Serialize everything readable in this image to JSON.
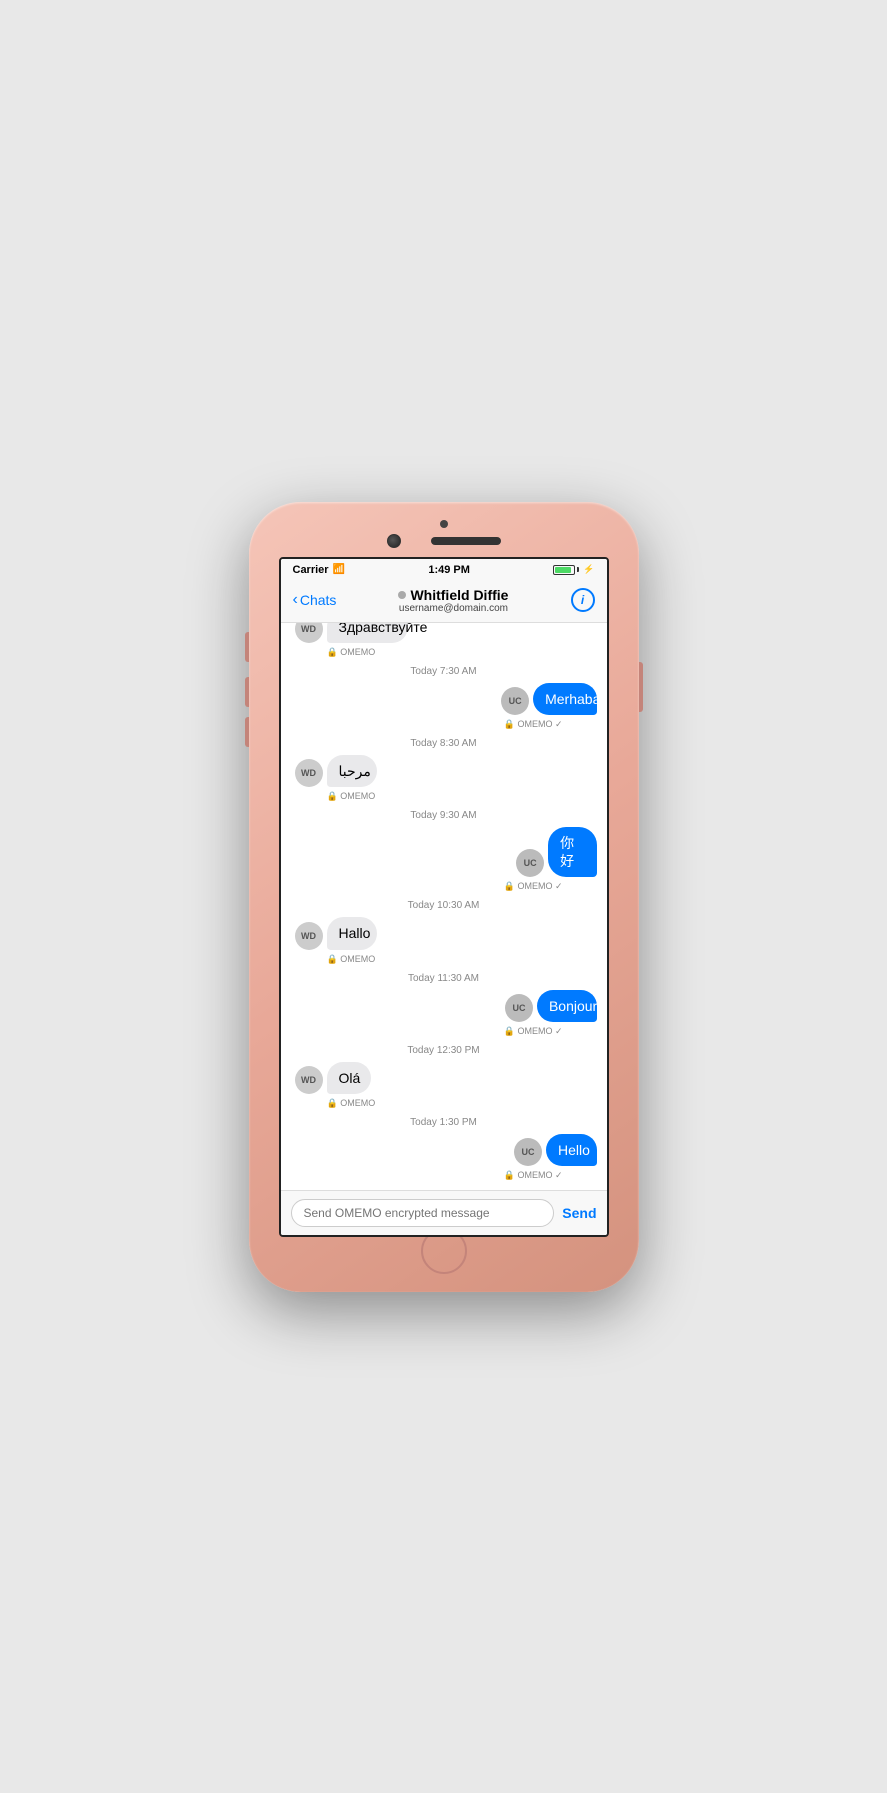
{
  "status_bar": {
    "carrier": "Carrier",
    "time": "1:49 PM",
    "wifi": "📶",
    "battery_level": "80"
  },
  "nav": {
    "back_label": "Chats",
    "contact_name": "Whitfield Diffie",
    "contact_email": "username@domain.com",
    "info_label": "i"
  },
  "messages": [
    {
      "type": "received",
      "text": "Здравствуйте",
      "avatar": "WD",
      "omemo": true,
      "timestamp": null
    },
    {
      "type": "timestamp",
      "text": "Today 7:30 AM"
    },
    {
      "type": "sent",
      "text": "Merhaba",
      "avatar": "UC",
      "omemo": true,
      "check": true
    },
    {
      "type": "timestamp",
      "text": "Today 8:30 AM"
    },
    {
      "type": "received",
      "text": "مرحبا",
      "avatar": "WD",
      "omemo": true
    },
    {
      "type": "timestamp",
      "text": "Today 9:30 AM"
    },
    {
      "type": "sent",
      "text": "你好",
      "avatar": "UC",
      "omemo": true,
      "check": true
    },
    {
      "type": "timestamp",
      "text": "Today 10:30 AM"
    },
    {
      "type": "received",
      "text": "Hallo",
      "avatar": "WD",
      "omemo": true
    },
    {
      "type": "timestamp",
      "text": "Today 11:30 AM"
    },
    {
      "type": "sent",
      "text": "Bonjour",
      "avatar": "UC",
      "omemo": true,
      "check": true
    },
    {
      "type": "timestamp",
      "text": "Today 12:30 PM"
    },
    {
      "type": "received",
      "text": "Olá",
      "avatar": "WD",
      "omemo": true
    },
    {
      "type": "timestamp",
      "text": "Today 1:30 PM"
    },
    {
      "type": "sent",
      "text": "Hello",
      "avatar": "UC",
      "omemo": true,
      "check": true
    }
  ],
  "input": {
    "placeholder": "Send OMEMO encrypted message",
    "send_label": "Send"
  }
}
